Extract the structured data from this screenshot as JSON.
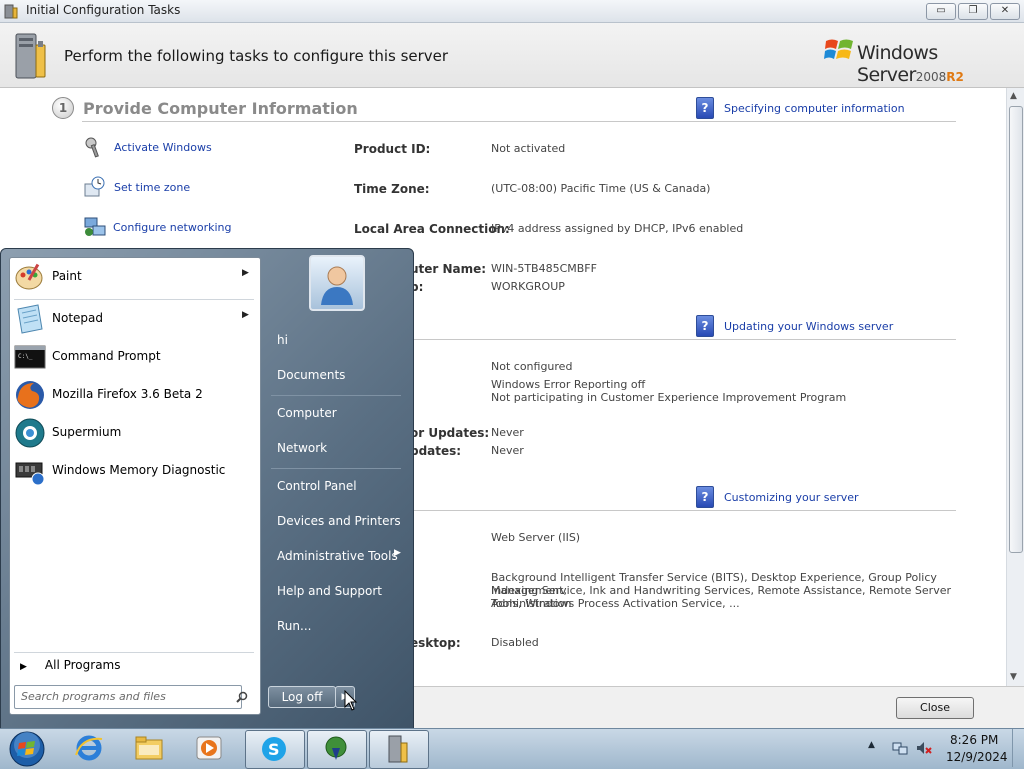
{
  "window": {
    "title": "Initial Configuration Tasks",
    "header": "Perform the following tasks to configure this server",
    "logo": {
      "brand": "Windows Server",
      "version": "2008",
      "edition": "R2"
    },
    "controls": {
      "minimize": "▭",
      "restore": "❐",
      "close": "✕"
    }
  },
  "section1": {
    "number": "1",
    "title": "Provide Computer Information",
    "help": "Specifying computer information",
    "tasks": [
      {
        "label": "Activate Windows",
        "icon": "key-icon"
      },
      {
        "label": "Set time zone",
        "icon": "clock-icon"
      },
      {
        "label": "Configure networking",
        "icon": "network-icon"
      }
    ],
    "rows": [
      {
        "label": "Product ID:",
        "value": "Not activated"
      },
      {
        "label": "Time Zone:",
        "value": "(UTC-08:00) Pacific Time (US & Canada)"
      },
      {
        "label": "Local Area Connection:",
        "value": "IPv4 address assigned by DHCP, IPv6 enabled"
      },
      {
        "label": "uter Name:",
        "value": "WIN-5TB485CMBFF"
      },
      {
        "label": "p:",
        "value": "WORKGROUP"
      }
    ]
  },
  "section2": {
    "help": "Updating your Windows server",
    "values": [
      "Not configured",
      "Windows Error Reporting off",
      "Not participating in Customer Experience Improvement Program"
    ],
    "rows": [
      {
        "label": "or Updates:",
        "value": "Never"
      },
      {
        "label": "pdates:",
        "value": "Never"
      }
    ]
  },
  "section3": {
    "help": "Customizing your server",
    "roles": "Web Server (IIS)",
    "features": [
      "Background Intelligent Transfer Service (BITS), Desktop Experience, Group Policy Management,",
      "Indexing Service, Ink and Handwriting Services, Remote Assistance, Remote Server Administration",
      "Tools, Windows Process Activation Service, ..."
    ],
    "desktop_label": "esktop:",
    "desktop_value": "Disabled"
  },
  "footer": {
    "close": "Close"
  },
  "start_menu": {
    "programs": [
      {
        "label": "Paint",
        "submenu": "▶",
        "icon": "paint-icon"
      },
      {
        "label": "Notepad",
        "submenu": "▶",
        "icon": "notepad-icon"
      },
      {
        "label": "Command Prompt",
        "icon": "cmd-icon"
      },
      {
        "label": "Mozilla Firefox 3.6 Beta 2",
        "icon": "firefox-icon"
      },
      {
        "label": "Supermium",
        "icon": "supermium-icon"
      },
      {
        "label": "Windows Memory Diagnostic",
        "icon": "memory-icon"
      }
    ],
    "all_programs": "All Programs",
    "all_programs_arrow": "▶",
    "search_placeholder": "Search programs and files",
    "right_items": [
      "hi",
      "Documents",
      "Computer",
      "Network",
      "Control Panel",
      "Devices and Printers",
      "Administrative Tools",
      "Help and Support",
      "Run..."
    ],
    "admin_arrow": "▶",
    "logoff": "Log off",
    "logoff_arrow": "▶"
  },
  "taskbar": {
    "tray_arrow": "▲",
    "clock_time": "8:26 PM",
    "clock_date": "12/9/2024"
  },
  "colors": {
    "link": "#1a3ea8",
    "accent": "#e07a14"
  }
}
